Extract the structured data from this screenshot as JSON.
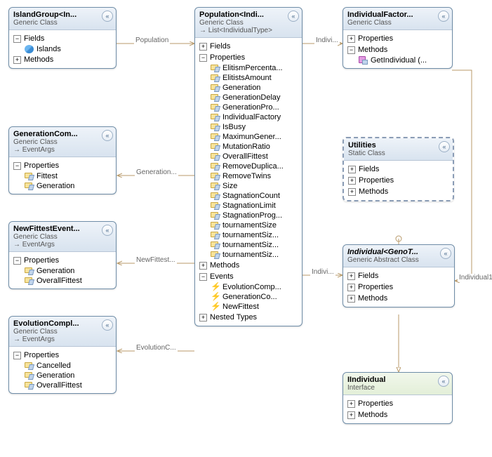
{
  "classes": {
    "islandGroup": {
      "title": "IslandGroup<In...",
      "sub": "Generic Class",
      "fields": [
        "Islands"
      ],
      "sectMethods": "Methods",
      "sectFields": "Fields"
    },
    "generationCom": {
      "title": "GenerationCom...",
      "sub": "Generic Class",
      "inherits": "EventArgs",
      "sectProps": "Properties",
      "props": [
        "Fittest",
        "Generation"
      ]
    },
    "newFittest": {
      "title": "NewFittestEvent...",
      "sub": "Generic Class",
      "inherits": "EventArgs",
      "sectProps": "Properties",
      "props": [
        "Generation",
        "OverallFittest"
      ]
    },
    "evolutionCompl": {
      "title": "EvolutionCompl...",
      "sub": "Generic Class",
      "inherits": "EventArgs",
      "sectProps": "Properties",
      "props": [
        "Cancelled",
        "Generation",
        "OverallFittest"
      ]
    },
    "population": {
      "title": "Population<Indi...",
      "sub": "Generic Class",
      "inherits": "List<IndividualType>",
      "sectFields": "Fields",
      "sectProps": "Properties",
      "sectMethods": "Methods",
      "sectEvents": "Events",
      "sectNested": "Nested Types",
      "props": [
        "ElitismPercenta...",
        "ElitistsAmount",
        "Generation",
        "GenerationDelay",
        "GenerationPro...",
        "IndividualFactory",
        "IsBusy",
        "MaximunGener...",
        "MutationRatio",
        "OverallFittest",
        "RemoveDuplica...",
        "RemoveTwins",
        "Size",
        "StagnationCount",
        "StagnationLimit",
        "StagnationProg...",
        "tournamentSize",
        "tournamentSiz...",
        "tournamentSiz...",
        "tournamentSiz..."
      ],
      "events": [
        "EvolutionComp...",
        "GenerationCo...",
        "NewFittest"
      ]
    },
    "individualFactor": {
      "title": "IndividualFactor...",
      "sub": "Generic Class",
      "sectProps": "Properties",
      "sectMethods": "Methods",
      "methods": [
        "GetIndividual  (..."
      ]
    },
    "utilities": {
      "title": "Utilities",
      "sub": "Static Class",
      "sectFields": "Fields",
      "sectProps": "Properties",
      "sectMethods": "Methods"
    },
    "individual": {
      "title": "Individual<GenoT...",
      "sub": "Generic Abstract Class",
      "sectFields": "Fields",
      "sectProps": "Properties",
      "sectMethods": "Methods"
    },
    "iindividual": {
      "title": "IIndividual",
      "sub": "Interface",
      "sectProps": "Properties",
      "sectMethods": "Methods"
    }
  },
  "labels": {
    "population": "Population",
    "generation": "Generation...",
    "newFittest": "NewFittest...",
    "evolutionC": "EvolutionC...",
    "indivi": "Indivi...",
    "individual1": "Individual1"
  },
  "glyph": {
    "plus": "+",
    "minus": "−",
    "chev": "«",
    "arrow": "→"
  }
}
